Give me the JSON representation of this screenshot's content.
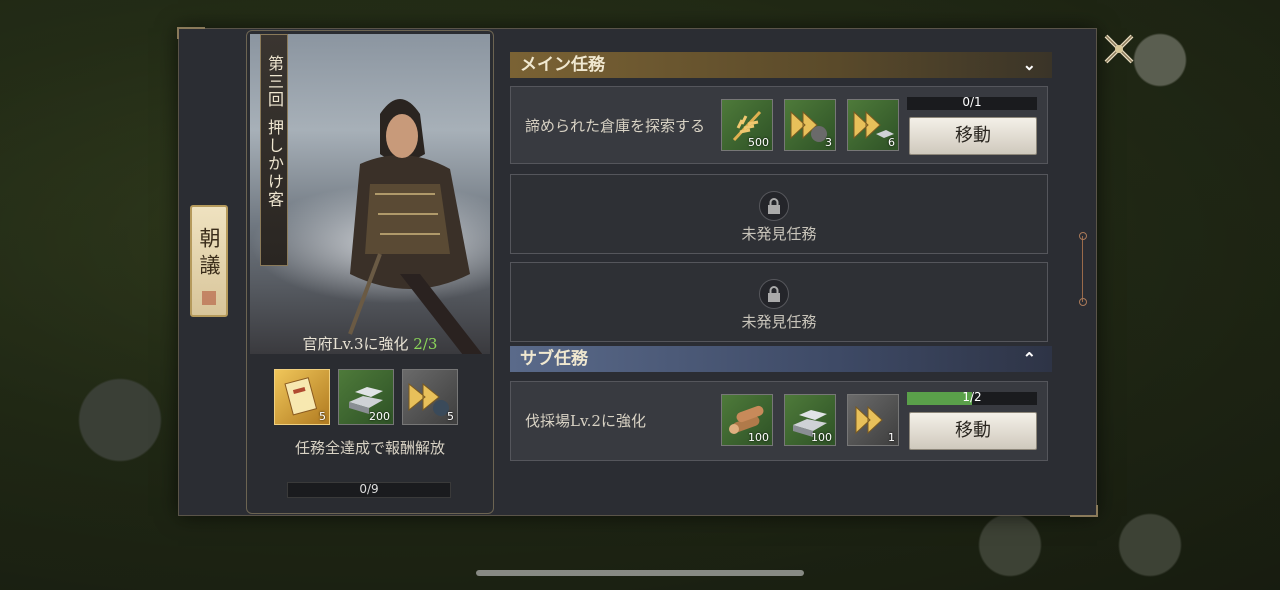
{
  "ribbon": {
    "label": "朝議"
  },
  "chapter": {
    "number": "第三回",
    "title": "押しかけ客"
  },
  "goal": {
    "text": "官府Lv.3に強化",
    "progress": "2/3"
  },
  "chapter_rewards": [
    {
      "icon": "scroll-book-icon",
      "qty": "5"
    },
    {
      "icon": "iron-ingot-icon",
      "qty": "200"
    },
    {
      "icon": "speedup-arrow-icon",
      "qty": "5"
    }
  ],
  "unlock_text": "任務全達成で報酬解放",
  "chapter_progress": {
    "text": "0/9",
    "fraction": 0.0
  },
  "main_section": {
    "title": "メイン任務"
  },
  "sub_section": {
    "title": "サブ任務"
  },
  "quests": [
    {
      "name": "諦められた倉庫を探索する",
      "progress": "0/1",
      "fraction": 0.0,
      "rewards": [
        {
          "icon": "wheat-icon",
          "qty": "500"
        },
        {
          "icon": "soldier-speedup-icon",
          "qty": "3"
        },
        {
          "icon": "iron-speedup-icon",
          "qty": "6"
        }
      ],
      "button": "移動"
    },
    {
      "name": "伐採場Lv.2に強化",
      "progress": "1/2",
      "fraction": 0.5,
      "rewards": [
        {
          "icon": "wood-icon",
          "qty": "100"
        },
        {
          "icon": "iron-ingot-icon",
          "qty": "100"
        },
        {
          "icon": "speedup-arrow-icon",
          "qty": "1"
        }
      ],
      "button": "移動"
    }
  ],
  "locked": [
    {
      "text": "未発見任務"
    },
    {
      "text": "未発見任務"
    }
  ],
  "colors": {
    "main_header": "#7a6234",
    "sub_header": "#5a6a8a",
    "progress_green": "#5aa04a",
    "gold": "#f0c65a"
  }
}
